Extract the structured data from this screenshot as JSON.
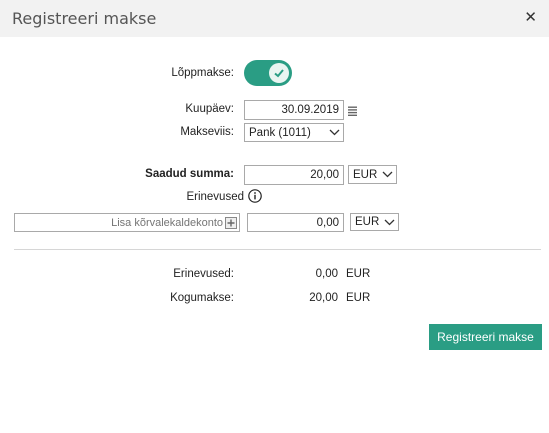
{
  "dialog": {
    "title": "Registreeri makse",
    "close_icon": "✕"
  },
  "form": {
    "final_payment_label": "Lõppmakse:",
    "final_payment_on": true,
    "date_label": "Kuupäev:",
    "date_value": "30.09.2019",
    "method_label": "Makseviis:",
    "method_value": "Pank (1011)",
    "received_label": "Saadud summa:",
    "received_value": "20,00",
    "received_currency": "EUR",
    "differences_label": "Erinevused",
    "deviation_account_placeholder": "Lisa kõrvalekaldekonto",
    "deviation_amount": "0,00",
    "deviation_currency": "EUR"
  },
  "summary": {
    "differences_label": "Erinevused:",
    "differences_value": "0,00",
    "differences_currency": "EUR",
    "total_label": "Kogumakse:",
    "total_value": "20,00",
    "total_currency": "EUR"
  },
  "actions": {
    "register_label": "Registreeri makse"
  },
  "colors": {
    "accent": "#2a9d84",
    "titlebar": "#f2f2f2"
  }
}
